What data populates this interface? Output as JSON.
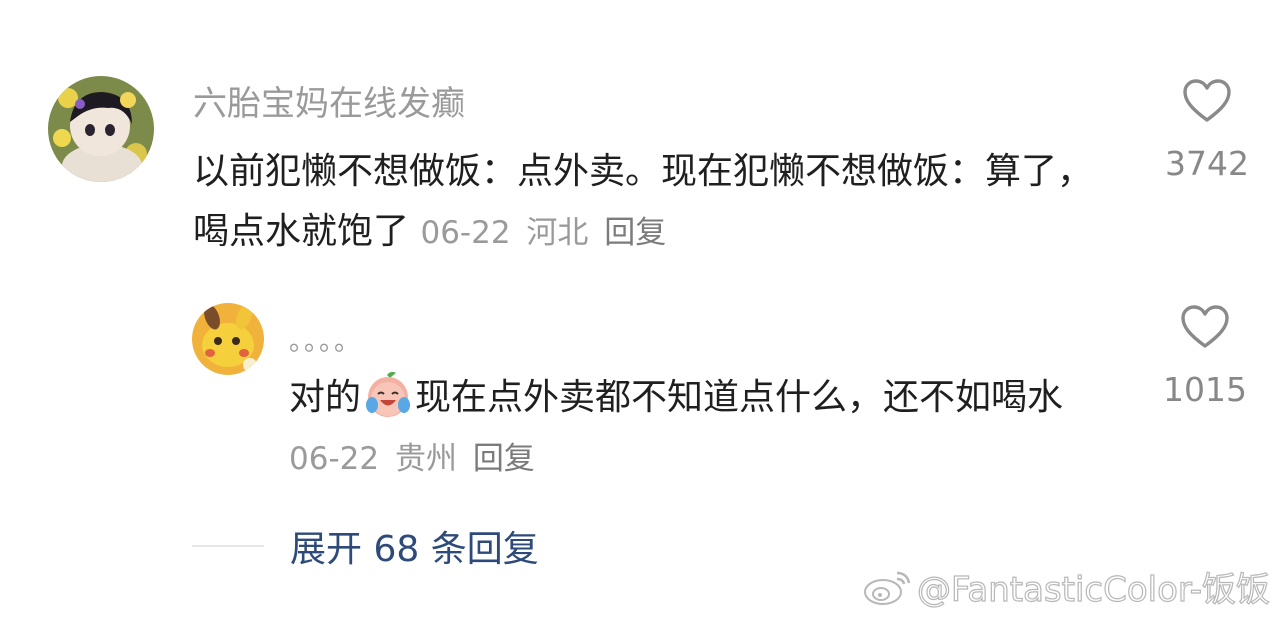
{
  "comment": {
    "username": "六胎宝妈在线发癫",
    "text": "以前犯懒不想做饭：点外卖。现在犯懒不想做饭：算了，喝点水就饱了",
    "date": "06-22",
    "location": "河北",
    "reply_label": "回复",
    "like_count": "3742"
  },
  "reply": {
    "username": "。。。。",
    "text_before_emoji": "对的",
    "emoji": "laughing-crying-peach-emoji",
    "text_after_emoji": "现在点外卖都不知道点什么，还不如喝水",
    "date": "06-22",
    "location": "贵州",
    "reply_label": "回复",
    "like_count": "1015"
  },
  "expand": {
    "label": "展开 68 条回复"
  },
  "watermark": {
    "text": "@FantasticColor-饭饭"
  },
  "colors": {
    "username": "#9a9a9a",
    "text": "#1f1f1f",
    "meta": "#9a9a9a",
    "expand_link": "#2e4a7a",
    "like_icon": "#8a8a8a"
  },
  "icons": {
    "like": "heart-outline-icon",
    "watermark_logo": "weibo-logo-icon"
  }
}
